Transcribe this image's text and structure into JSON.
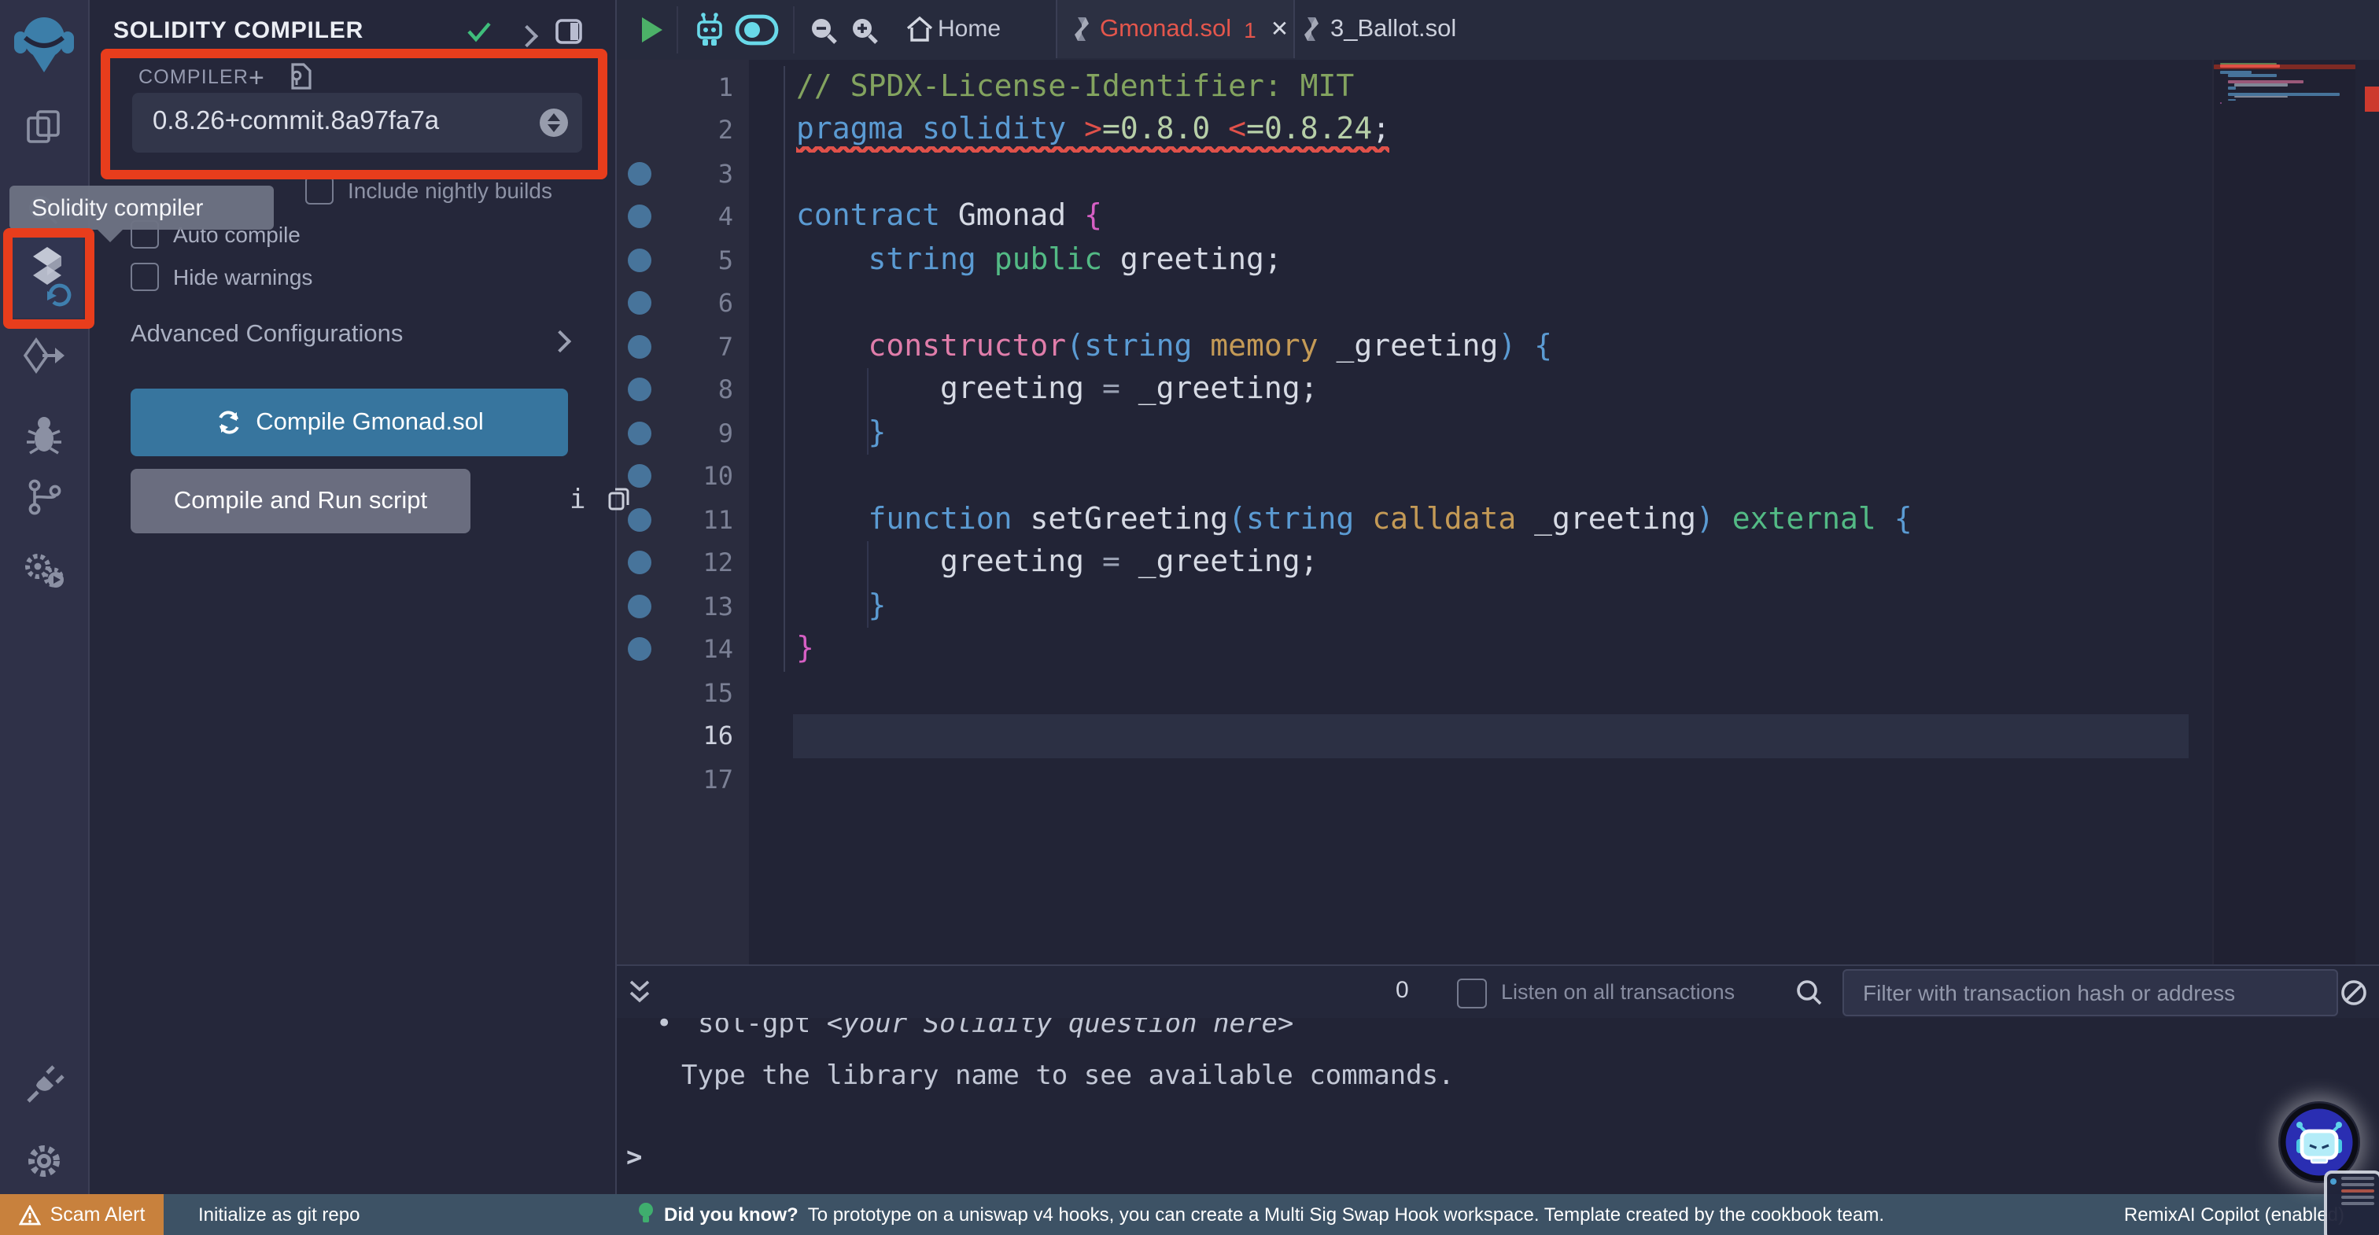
{
  "tooltip": {
    "text": "Solidity compiler"
  },
  "activity_bar": {
    "icons": [
      {
        "name": "remix-logo"
      },
      {
        "name": "file-explorer"
      },
      {
        "name": "search"
      },
      {
        "name": "solidity-compiler",
        "active": true
      },
      {
        "name": "deploy-and-run"
      },
      {
        "name": "debugger"
      },
      {
        "name": "git"
      },
      {
        "name": "solidity-analyzers"
      },
      {
        "name": "plugin-manager"
      },
      {
        "name": "settings"
      }
    ]
  },
  "side_panel": {
    "title": "SOLIDITY COMPILER",
    "compiler_section_label": "COMPILER",
    "compiler_version": "0.8.26+commit.8a97fa7a",
    "checkbox_nightly": "Include nightly builds",
    "checkbox_autocompile": "Auto compile",
    "checkbox_hide_warnings": "Hide warnings",
    "advanced_label": "Advanced Configurations",
    "compile_button_label": "Compile Gmonad.sol",
    "compile_run_button_label": "Compile and Run script",
    "info_glyph": "i"
  },
  "toolbar": {
    "home_label": "Home"
  },
  "tabs": [
    {
      "label": "Gmonad.sol",
      "badge": "1",
      "close_glyph": "✕",
      "active": true,
      "color": "#e4564c"
    },
    {
      "label": "3_Ballot.sol",
      "active": false,
      "color": "#ccd0dc"
    }
  ],
  "editor": {
    "total_lines": 17,
    "active_line": 16,
    "error_line": 2,
    "gutter_dot_lines": [
      3,
      4,
      5,
      6,
      7,
      8,
      9,
      10,
      11,
      12,
      13,
      14
    ],
    "lines": [
      {
        "n": 1,
        "tokens": [
          [
            "comment",
            "// SPDX-License-Identifier: MIT"
          ]
        ]
      },
      {
        "n": 2,
        "tokens": [
          [
            "kw",
            "pragma solidity "
          ],
          [
            "red",
            ">"
          ],
          [
            "num",
            "=0.8.0"
          ],
          [
            "plain",
            " "
          ],
          [
            "red",
            "<"
          ],
          [
            "num",
            "=0.8.24"
          ],
          [
            "plain",
            ";"
          ]
        ]
      },
      {
        "n": 3,
        "tokens": []
      },
      {
        "n": 4,
        "tokens": [
          [
            "kw",
            "contract "
          ],
          [
            "plain",
            "Gmonad "
          ],
          [
            "magenta",
            "{"
          ]
        ]
      },
      {
        "n": 5,
        "tokens": [
          [
            "plain",
            "    "
          ],
          [
            "kw",
            "string "
          ],
          [
            "green",
            "public "
          ],
          [
            "plain",
            "greeting;"
          ]
        ]
      },
      {
        "n": 6,
        "tokens": []
      },
      {
        "n": 7,
        "tokens": [
          [
            "plain",
            "    "
          ],
          [
            "pink",
            "constructor"
          ],
          [
            "kw",
            "("
          ],
          [
            "kw",
            "string "
          ],
          [
            "gold",
            "memory"
          ],
          [
            "plain",
            " _greeting"
          ],
          [
            "kw",
            ") {"
          ]
        ]
      },
      {
        "n": 8,
        "tokens": [
          [
            "plain",
            "        greeting "
          ],
          [
            "dim",
            "= "
          ],
          [
            "plain",
            "_greeting;"
          ]
        ]
      },
      {
        "n": 9,
        "tokens": [
          [
            "plain",
            "    "
          ],
          [
            "kw",
            "}"
          ]
        ]
      },
      {
        "n": 10,
        "tokens": []
      },
      {
        "n": 11,
        "tokens": [
          [
            "plain",
            "    "
          ],
          [
            "kw",
            "function "
          ],
          [
            "plain",
            "setGreeting"
          ],
          [
            "kw",
            "("
          ],
          [
            "kw",
            "string "
          ],
          [
            "gold",
            "calldata"
          ],
          [
            "plain",
            " _greeting"
          ],
          [
            "kw",
            ")"
          ],
          [
            "green",
            " external"
          ],
          [
            "kw",
            " {"
          ]
        ]
      },
      {
        "n": 12,
        "tokens": [
          [
            "plain",
            "        greeting "
          ],
          [
            "dim",
            "= "
          ],
          [
            "plain",
            "_greeting;"
          ]
        ]
      },
      {
        "n": 13,
        "tokens": [
          [
            "plain",
            "    "
          ],
          [
            "kw",
            "}"
          ]
        ]
      },
      {
        "n": 14,
        "tokens": [
          [
            "magenta",
            "}"
          ]
        ]
      },
      {
        "n": 15,
        "tokens": []
      },
      {
        "n": 16,
        "tokens": []
      },
      {
        "n": 17,
        "tokens": []
      }
    ]
  },
  "terminal": {
    "badge": "0",
    "listen_label": "Listen on all transactions",
    "filter_placeholder": "Filter with transaction hash or address",
    "line1_bullet": "•",
    "line1_prefix": "sol-gpt ",
    "line1_italic": "<your Solidity question here>",
    "line2": "Type the library name to see available commands.",
    "prompt": ">"
  },
  "status_bar": {
    "scam_alert": "Scam Alert",
    "git_label": "Initialize as git repo",
    "tip_title": "Did you know?",
    "tip_text": "To prototype on a uniswap v4 hooks, you can create a Multi Sig Swap Hook workspace. Template created by the cookbook team.",
    "copilot": "RemixAI Copilot (enabled)"
  },
  "colors": {
    "annotation_red": "#e83d1c",
    "compile_button": "#37759e",
    "run_button": "#6a6d7f",
    "scam_orange": "#c8813d",
    "status_bar": "#3d5265",
    "active_tab_file": "#e4564c",
    "gutter_dot": "#47749b",
    "error": "#e0514a",
    "cyan_icons": "#69d9e9",
    "play_green": "#4cb168",
    "check_green": "#3fbe7b"
  }
}
